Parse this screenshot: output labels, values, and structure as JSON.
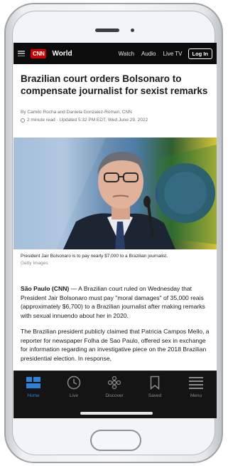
{
  "nav": {
    "logo": "CNN",
    "section": "World",
    "links": [
      "Watch",
      "Audio",
      "Live TV"
    ],
    "login": "Log In"
  },
  "article": {
    "headline": "Brazilian court orders Bolsonaro to compensate journalist for sexist remarks",
    "byline": "By Camilo Rocha and Daniela Gonzalez-Roman, CNN",
    "read_time": "2 minute read",
    "updated": "Updated 5:32 PM EDT, Wed June 29, 2022",
    "image_caption": "President Jair Bolsonaro is to pay nearly $7,000 to a Brazilian journalist.",
    "image_credit": "Getty Images",
    "para1_dateline": "São Paulo (CNN)",
    "para1_text": " — A Brazilian court ruled on Wednesday that President Jair Bolsonaro must pay \"moral damages\" of 35,000 reais (approximately $6,700) to a Brazilian journalist after making remarks with sexual innuendo about her in 2020.",
    "para2_text": "The Brazilian president publicly claimed that Patricia Campos Mello, a reporter for newspaper Folha de Sao Paulo, offered sex in exchange for information regarding an investigative piece on the 2018 Brazilian presidential election. In response,"
  },
  "tabs": [
    {
      "label": "Home",
      "icon": "home-icon",
      "active": true
    },
    {
      "label": "Live",
      "icon": "clock-icon"
    },
    {
      "label": "Discover",
      "icon": "discover-icon"
    },
    {
      "label": "Saved",
      "icon": "bookmark-icon"
    },
    {
      "label": "Menu",
      "icon": "menu-icon"
    }
  ],
  "colors": {
    "brand": "#cc0000",
    "active_tab": "#2f82d6",
    "nav_bg": "#0c0c0c"
  }
}
